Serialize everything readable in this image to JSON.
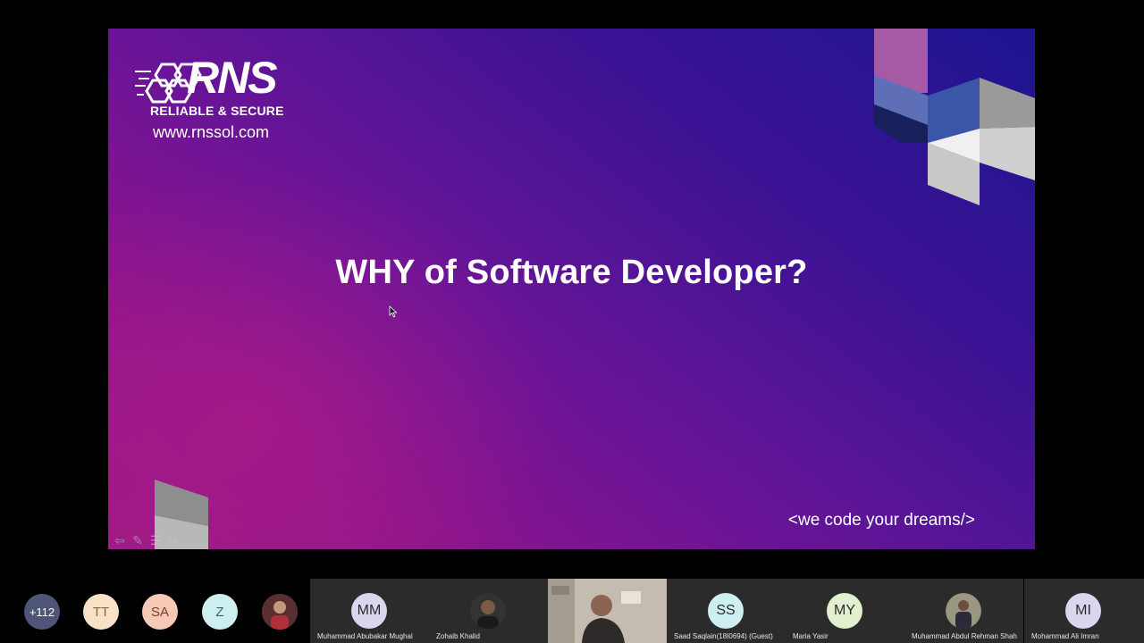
{
  "slide": {
    "logo_text": "RNS",
    "tagline": "RELIABLE & SECURE",
    "website": "www.rnssol.com",
    "title": "WHY of Software Developer?",
    "motto": "<we code your dreams/>"
  },
  "participants": {
    "overflow_count": "+112",
    "small_avatars": [
      {
        "initials": "TT",
        "color": "#f7e2c8"
      },
      {
        "initials": "SA",
        "color": "#f6c9b6"
      },
      {
        "initials": "Z",
        "color": "#cdeff0"
      }
    ],
    "tiles": [
      {
        "initials": "MM",
        "name": "Muhammad Abubakar Mughal",
        "color": "#d9d6f0"
      },
      {
        "initials": "",
        "name": "Zohaib Khalid",
        "color": "#333333"
      },
      {
        "initials": "",
        "name": "",
        "color": "#b9b1a6"
      },
      {
        "initials": "SS",
        "name": "Saad Saqlain(18I0694) (Guest)",
        "color": "#cdeff0"
      },
      {
        "initials": "MY",
        "name": "Maria Yasir",
        "color": "#e3f0cf"
      },
      {
        "initials": "",
        "name": "Muhammad Abdul Rehman Shah",
        "color": "#8a8a7a"
      },
      {
        "initials": "MI",
        "name": "Mohammad Ali Imran",
        "color": "#d9d6f0"
      }
    ]
  },
  "colors": {
    "slide_blue": "#1c148f",
    "slide_magenta": "#9c1a86",
    "tile_bg": "#2b2b2b"
  }
}
